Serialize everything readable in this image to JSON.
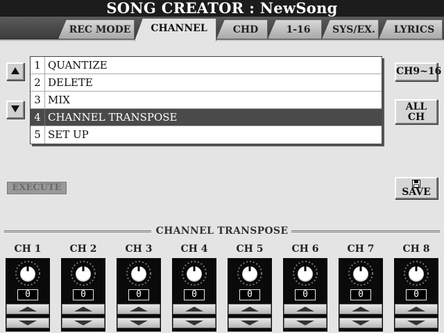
{
  "title": "SONG CREATOR : NewSong",
  "tabs": [
    {
      "label": "REC MODE",
      "active": false
    },
    {
      "label": "CHANNEL",
      "active": true
    },
    {
      "label": "CHD",
      "active": false
    },
    {
      "label": "1-16",
      "active": false
    },
    {
      "label": "SYS/EX.",
      "active": false
    },
    {
      "label": "LYRICS",
      "active": false
    }
  ],
  "menu": {
    "items": [
      {
        "num": "1",
        "label": "QUANTIZE"
      },
      {
        "num": "2",
        "label": "DELETE"
      },
      {
        "num": "3",
        "label": "MIX"
      },
      {
        "num": "4",
        "label": "CHANNEL TRANSPOSE",
        "selected": true
      },
      {
        "num": "5",
        "label": "SET UP"
      }
    ],
    "up_icon": "triangle-up-icon",
    "down_icon": "triangle-down-icon"
  },
  "buttons": {
    "ch9_16": "CH9~16",
    "all_ch_1": "ALL",
    "all_ch_2": "CH",
    "execute": "EXECUTE",
    "save": "SAVE",
    "save_icon": "floppy-disk-icon"
  },
  "section_title": "CHANNEL TRANSPOSE",
  "channels": [
    {
      "name": "CH 1",
      "value": "0"
    },
    {
      "name": "CH 2",
      "value": "0"
    },
    {
      "name": "CH 3",
      "value": "0"
    },
    {
      "name": "CH 4",
      "value": "0"
    },
    {
      "name": "CH 5",
      "value": "0"
    },
    {
      "name": "CH 6",
      "value": "0"
    },
    {
      "name": "CH 7",
      "value": "0"
    },
    {
      "name": "CH 8",
      "value": "0"
    }
  ],
  "colors": {
    "selected_row": "#4a4a4a",
    "panel": "#e4e4e4",
    "dark": "#1c1c1c"
  }
}
